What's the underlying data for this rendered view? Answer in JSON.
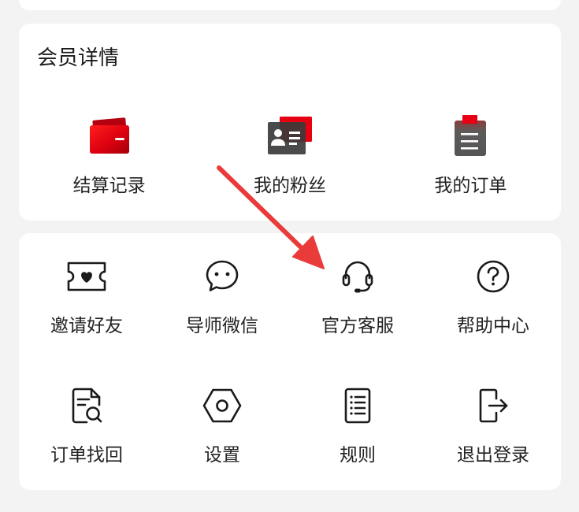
{
  "member_section": {
    "title": "会员详情",
    "items": [
      {
        "label": "结算记录",
        "icon": "wallet-icon"
      },
      {
        "label": "我的粉丝",
        "icon": "id-card-icon"
      },
      {
        "label": "我的订单",
        "icon": "clipboard-icon"
      }
    ]
  },
  "services_section": {
    "items": [
      {
        "label": "邀请好友",
        "icon": "ticket-heart-icon"
      },
      {
        "label": "导师微信",
        "icon": "chat-bubble-icon"
      },
      {
        "label": "官方客服",
        "icon": "headset-icon"
      },
      {
        "label": "帮助中心",
        "icon": "help-circle-icon"
      },
      {
        "label": "订单找回",
        "icon": "document-search-icon"
      },
      {
        "label": "设置",
        "icon": "settings-hexagon-icon"
      },
      {
        "label": "规则",
        "icon": "rules-list-icon"
      },
      {
        "label": "退出登录",
        "icon": "logout-icon"
      }
    ]
  },
  "theme": {
    "background": "#f3f3f3",
    "card": "#ffffff",
    "text": "#1a1a1a",
    "brand_red": "#e60012",
    "annotation_arrow": "#ea3b3b"
  }
}
